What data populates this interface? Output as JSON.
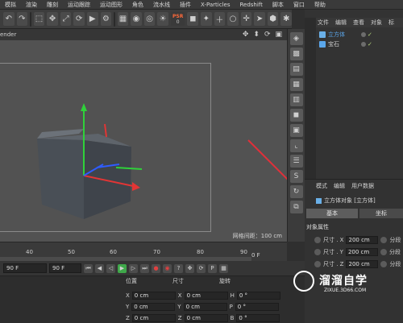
{
  "menu": [
    "模拟",
    "渲染",
    "雕刻",
    "运动跟踪",
    "运动图形",
    "角色",
    "流水线",
    "插件",
    "X-Particles",
    "Redshift",
    "脚本",
    "窗口",
    "帮助"
  ],
  "toolbar": {
    "psr_label": "PSR",
    "psr_value": "0"
  },
  "viewport": {
    "title": "ender",
    "status": "网格间距：100 cm",
    "nav_icons": [
      "move-icon",
      "zoom-icon",
      "rotate-icon",
      "layout-icon"
    ]
  },
  "object_manager": {
    "menu": [
      "文件",
      "编辑",
      "查看",
      "对象",
      "标"
    ],
    "objects": [
      {
        "name": "立方体",
        "selected": true,
        "check": "✓"
      },
      {
        "name": "宝石",
        "selected": false,
        "check": "✓"
      }
    ]
  },
  "attribute_manager": {
    "menu": [
      "模式",
      "编辑",
      "用户数据"
    ],
    "object_title": "立方体对象 [立方体]",
    "tabs": [
      "基本",
      "坐标"
    ],
    "section": "对象属性",
    "rows": [
      {
        "label": "尺寸 . X",
        "value": "200 cm",
        "extra": "分段"
      },
      {
        "label": "尺寸 . Y",
        "value": "200 cm",
        "extra": "分段"
      },
      {
        "label": "尺寸 . Z",
        "value": "200 cm",
        "extra": "分段"
      }
    ]
  },
  "timeline": {
    "ticks": [
      "40",
      "50",
      "60",
      "70",
      "80",
      "90"
    ],
    "current_frame": "0 F"
  },
  "transport": {
    "start": "90 F",
    "end": "90 F"
  },
  "coordinates": {
    "headers": [
      "位置",
      "尺寸",
      "旋转"
    ],
    "rows": [
      {
        "axis": "X",
        "pos": "0 cm",
        "size_axis": "X",
        "size": "0 cm",
        "rot_axis": "H",
        "rot": "0 °"
      },
      {
        "axis": "Y",
        "pos": "0 cm",
        "size_axis": "Y",
        "size": "0 cm",
        "rot_axis": "P",
        "rot": "0 °"
      },
      {
        "axis": "Z",
        "pos": "0 cm",
        "size_axis": "Z",
        "size": "0 cm",
        "rot_axis": "B",
        "rot": "0 °"
      }
    ]
  },
  "watermark": {
    "text": "溜溜自学",
    "sub": "ZIXUE.3D66.COM"
  },
  "colors": {
    "accent_blue": "#5aa6ea",
    "arrow_red": "#e0303a",
    "axis_green": "#2fd13a",
    "axis_red": "#e23535",
    "axis_blue": "#2f5cff"
  }
}
